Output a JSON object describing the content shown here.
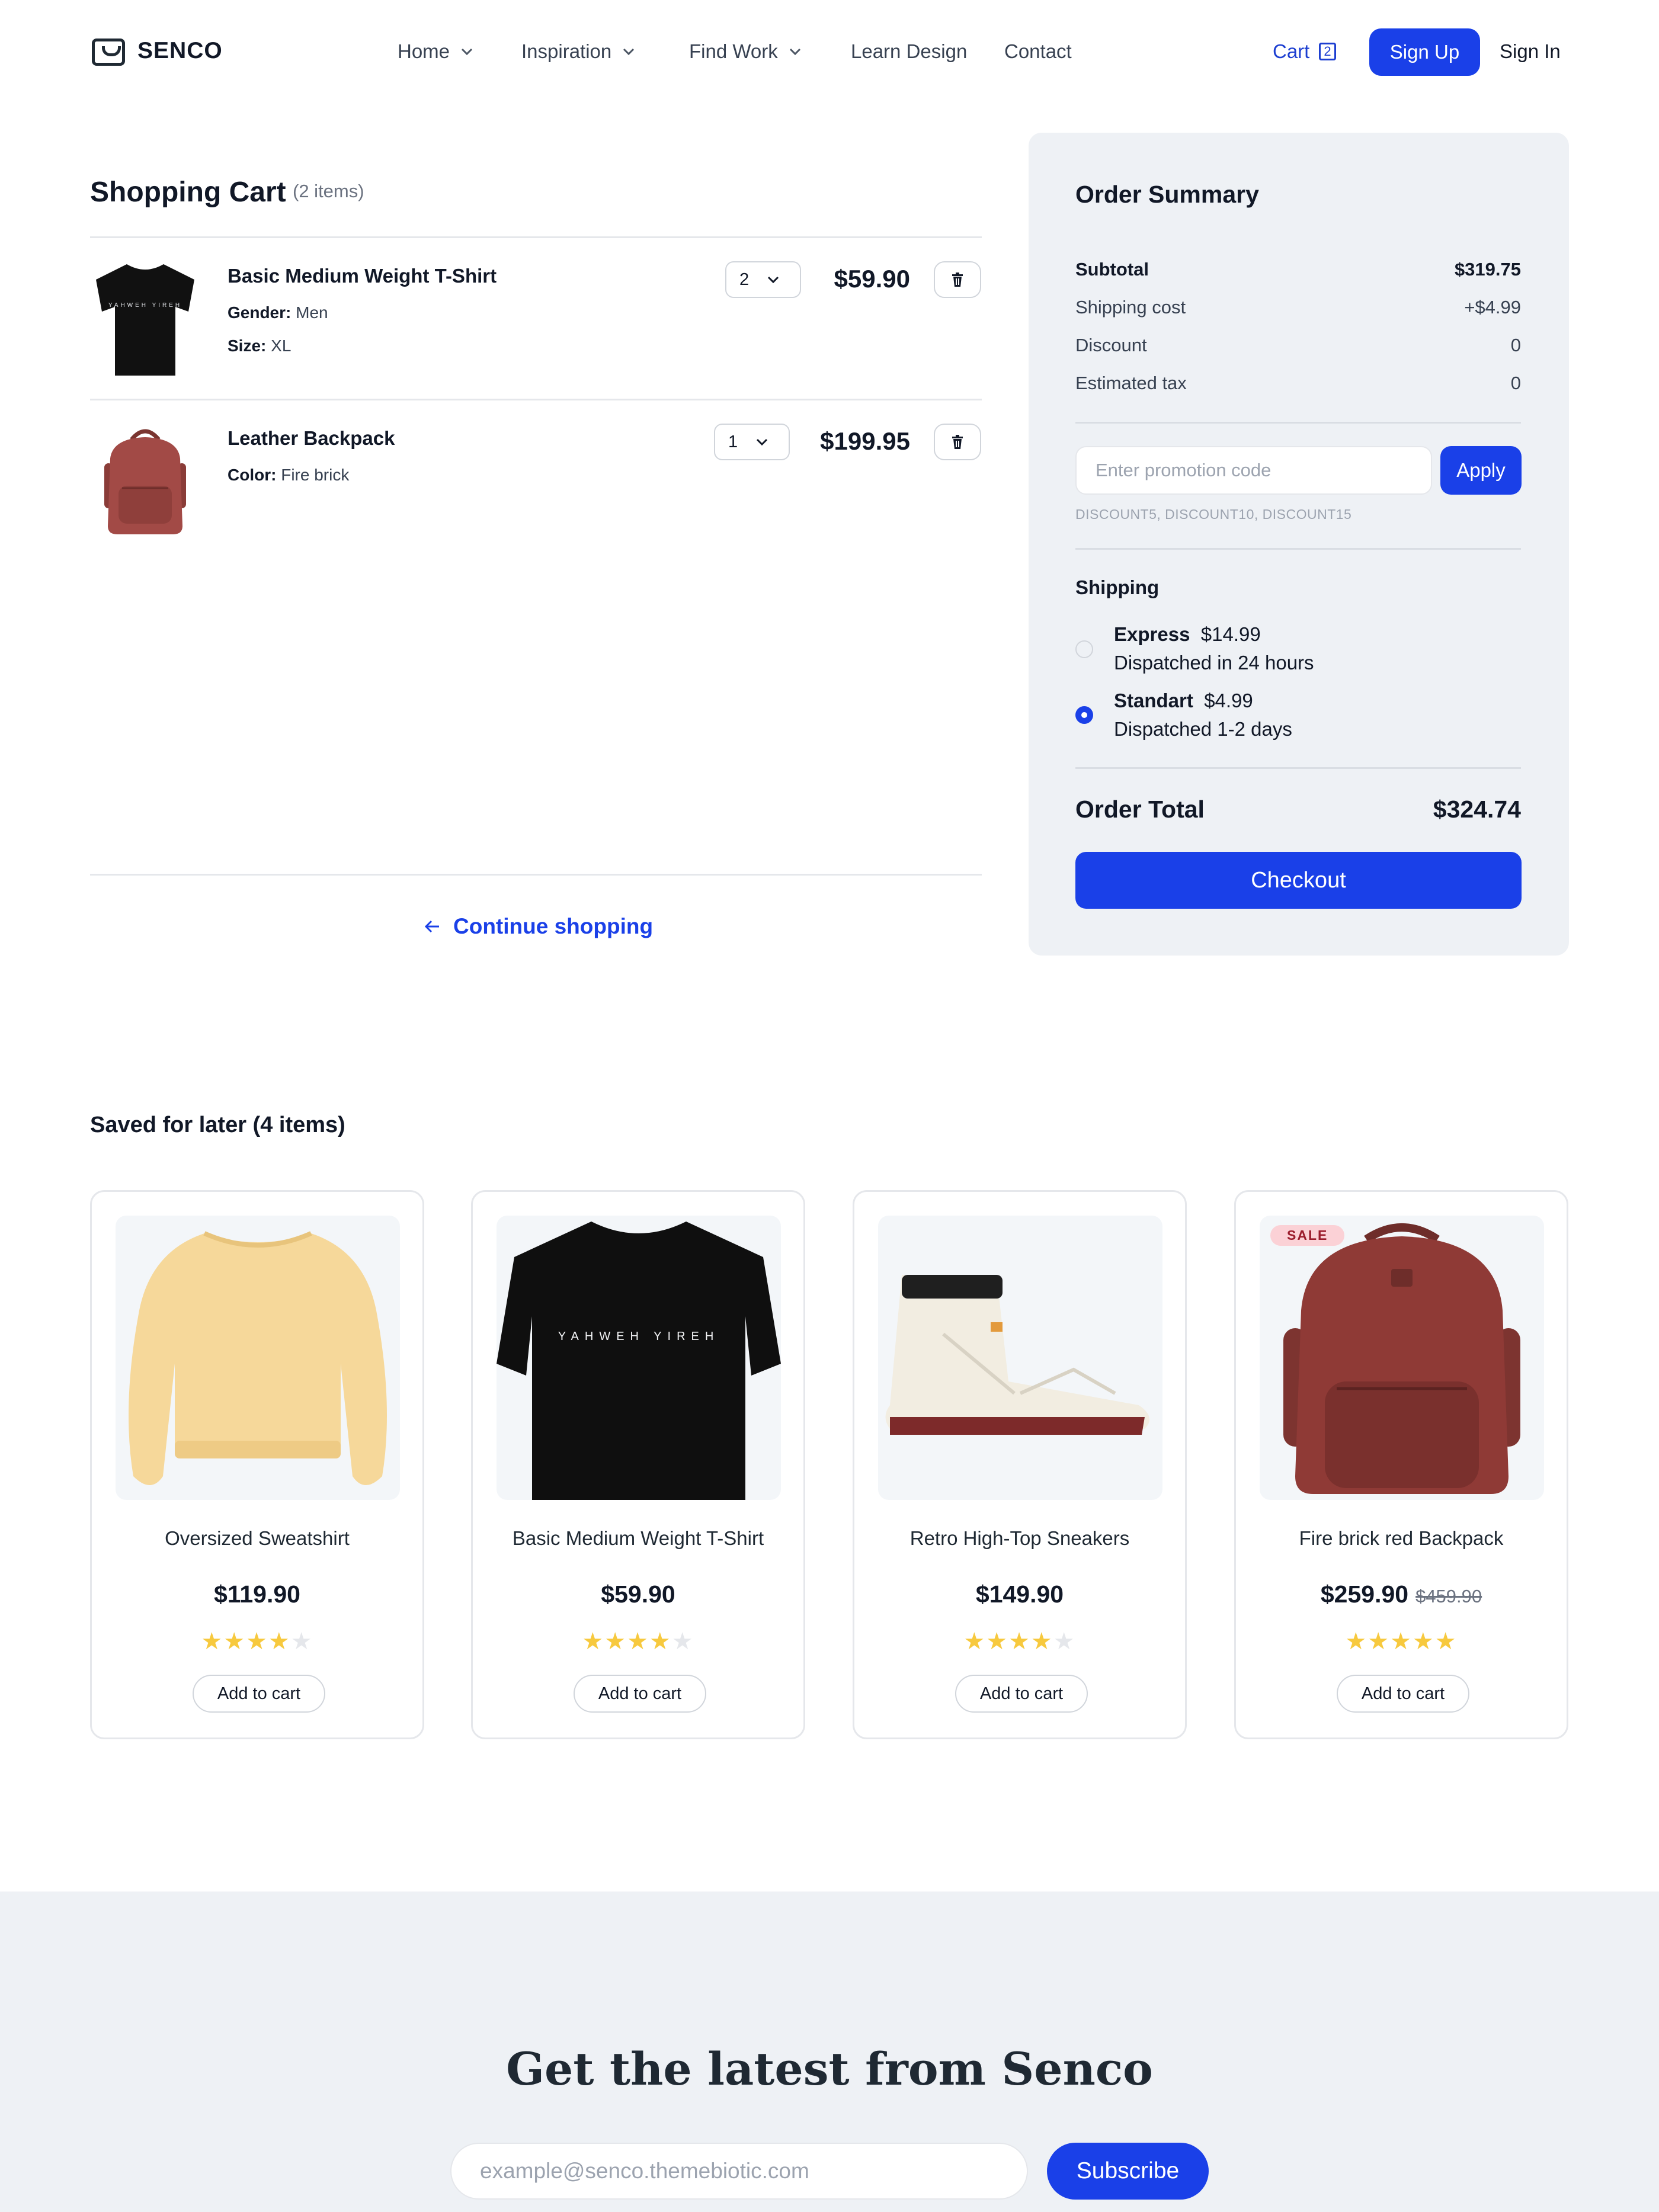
{
  "header": {
    "brand": "SENCO",
    "nav": [
      {
        "label": "Home",
        "has_dropdown": true
      },
      {
        "label": "Inspiration",
        "has_dropdown": true
      },
      {
        "label": "Find Work",
        "has_dropdown": true
      },
      {
        "label": "Learn Design",
        "has_dropdown": false
      },
      {
        "label": "Contact",
        "has_dropdown": false
      }
    ],
    "cart_label": "Cart",
    "cart_count": "2",
    "signup_label": "Sign Up",
    "signin_label": "Sign In"
  },
  "cart": {
    "title": "Shopping Cart",
    "count_label": "(2 items)",
    "items": [
      {
        "name": "Basic Medium Weight T-Shirt",
        "attrs": [
          {
            "key": "Gender:",
            "value": "Men"
          },
          {
            "key": "Size:",
            "value": "XL"
          }
        ],
        "qty": "2",
        "price": "$59.90",
        "print_text": "YAHWEH YIREH"
      },
      {
        "name": "Leather Backpack",
        "attrs": [
          {
            "key": "Color:",
            "value": "Fire brick"
          }
        ],
        "qty": "1",
        "price": "$199.95"
      }
    ],
    "continue_label": "Continue shopping"
  },
  "summary": {
    "title": "Order Summary",
    "rows": [
      {
        "label": "Subtotal",
        "value": "$319.75"
      },
      {
        "label": "Shipping cost",
        "value": "+$4.99"
      },
      {
        "label": "Discount",
        "value": "0"
      },
      {
        "label": "Estimated tax",
        "value": "0"
      }
    ],
    "promo_placeholder": "Enter promotion code",
    "apply_label": "Apply",
    "promo_codes": "DISCOUNT5, DISCOUNT10, DISCOUNT15",
    "shipping_title": "Shipping",
    "shipping_options": [
      {
        "name": "Express",
        "price": "$14.99",
        "desc": "Dispatched in 24 hours",
        "selected": false
      },
      {
        "name": "Standart",
        "price": "$4.99",
        "desc": "Dispatched 1-2 days",
        "selected": true
      }
    ],
    "total_label": "Order Total",
    "total_value": "$324.74",
    "checkout_label": "Checkout"
  },
  "saved": {
    "title": "Saved for later (4 items)",
    "products": [
      {
        "name": "Oversized Sweatshirt",
        "price": "$119.90",
        "old_price": "",
        "rating": 4,
        "sale": false,
        "add_label": "Add to cart"
      },
      {
        "name": "Basic Medium Weight T-Shirt",
        "price": "$59.90",
        "old_price": "",
        "rating": 4,
        "sale": false,
        "add_label": "Add to cart",
        "print_text": "YAHWEH YIREH"
      },
      {
        "name": "Retro High-Top Sneakers",
        "price": "$149.90",
        "old_price": "",
        "rating": 4,
        "sale": false,
        "add_label": "Add to cart"
      },
      {
        "name": "Fire brick red Backpack",
        "price": "$259.90",
        "old_price": "$459.90",
        "rating": 5,
        "sale": true,
        "sale_label": "SALE",
        "add_label": "Add to cart"
      }
    ]
  },
  "newsletter": {
    "title": "Get the latest from Senco",
    "email_placeholder": "example@senco.themebiotic.com",
    "subscribe_label": "Subscribe"
  },
  "colors": {
    "accent": "#1a40e8",
    "panel": "#eef1f5",
    "star": "#f7c93e",
    "sale_bg": "#fbd1d6"
  }
}
